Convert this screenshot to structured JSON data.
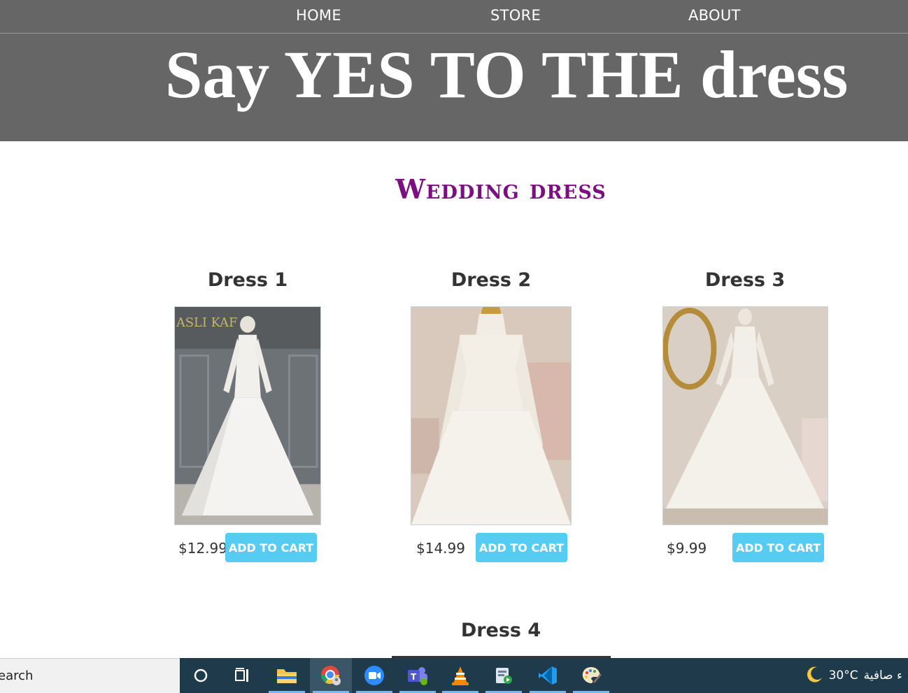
{
  "nav": {
    "home": "HOME",
    "store": "STORE",
    "about": "ABOUT"
  },
  "band": {
    "title": "Say YES TO THE dress"
  },
  "section": {
    "title": "Wedding dress"
  },
  "items": [
    {
      "title": "Dress 1",
      "price": "$12.99",
      "button": "ADD TO CART"
    },
    {
      "title": "Dress 2",
      "price": "$14.99",
      "button": "ADD TO CART"
    },
    {
      "title": "Dress 3",
      "price": "$9.99",
      "button": "ADD TO CART"
    },
    {
      "title": "Dress 4"
    }
  ],
  "taskbar": {
    "search_text": "earch",
    "temperature": "30°C",
    "weather_text": "ء صافية",
    "icons": [
      "cortana-icon",
      "task-view-icon",
      "file-explorer-icon",
      "chrome-icon",
      "zoom-icon",
      "teams-icon",
      "vlc-icon",
      "media-icon",
      "vscode-icon",
      "paint-icon"
    ]
  },
  "colors": {
    "header_bg": "#666666",
    "accent_button": "#56ccf2",
    "section_title": "#7b0e80",
    "taskbar_bg": "#1f3a4a"
  }
}
